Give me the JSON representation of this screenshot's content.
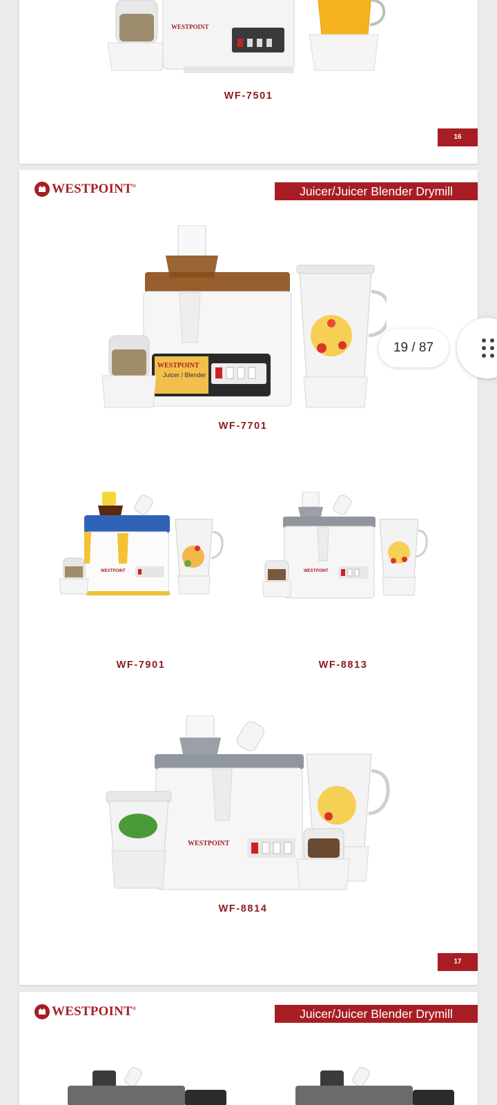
{
  "viewer": {
    "page_counter": "19 / 87"
  },
  "pages": [
    {
      "products": [
        {
          "model": "WF-7501"
        }
      ],
      "page_number": "16"
    },
    {
      "brand": "WESTPOINT",
      "brand_mark": "®",
      "category": "Juicer/Juicer Blender Drymill",
      "products": [
        {
          "model": "WF-7701"
        },
        {
          "model": "WF-7901"
        },
        {
          "model": "WF-8813"
        },
        {
          "model": "WF-8814"
        }
      ],
      "page_number": "17"
    },
    {
      "brand": "WESTPOINT",
      "brand_mark": "®",
      "category": "Juicer/Juicer Blender Drymill"
    }
  ],
  "icons": {
    "menu": "grid-dots-icon"
  },
  "colors": {
    "brand_red": "#a81d24",
    "model_text": "#8e1b21",
    "background": "#ebebeb"
  }
}
